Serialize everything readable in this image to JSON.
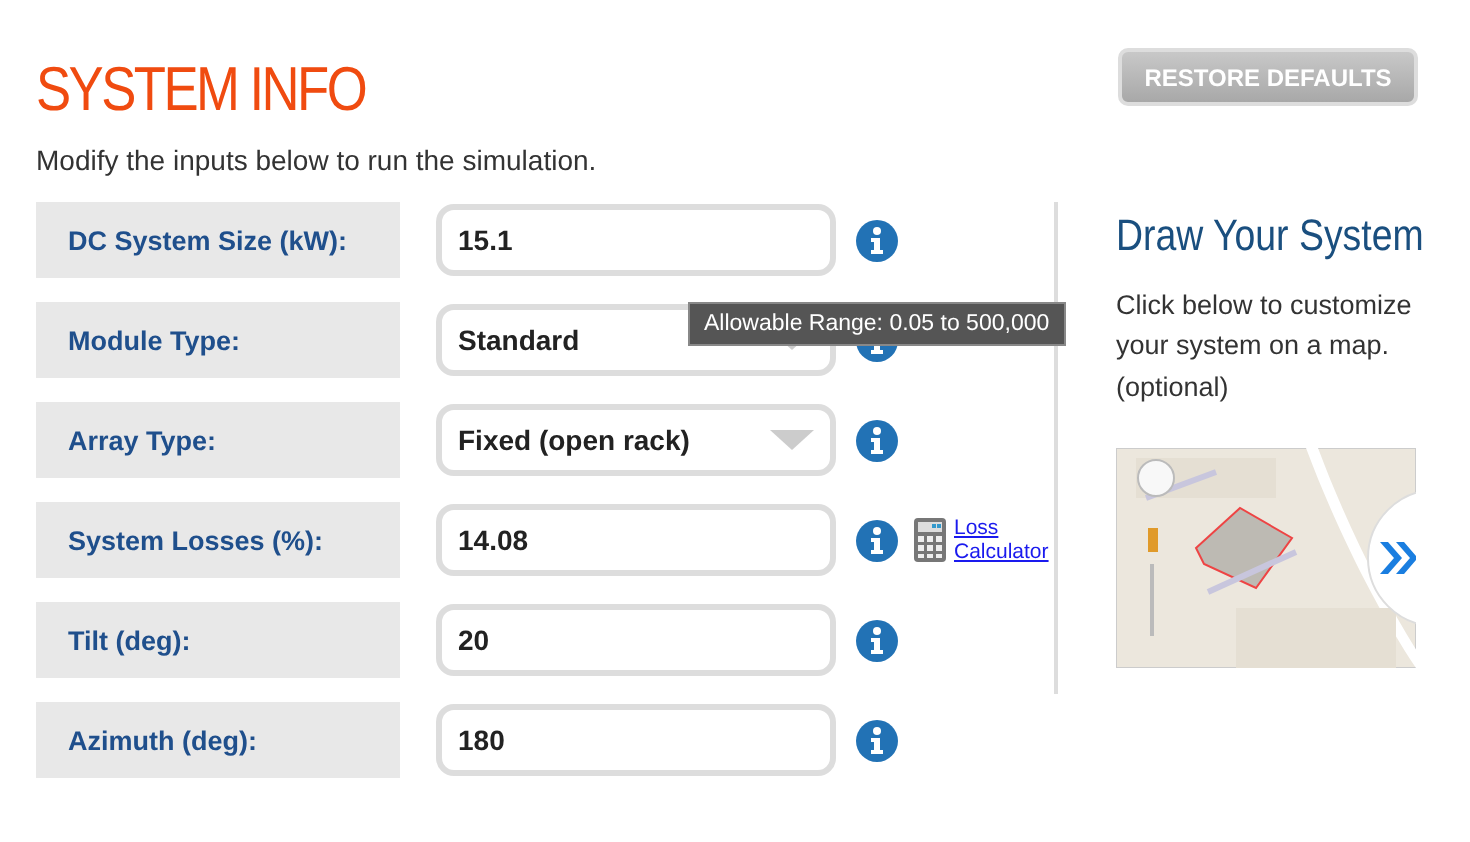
{
  "title": "SYSTEM INFO",
  "restore_button": "RESTORE DEFAULTS",
  "intro": "Modify the inputs below to run the simulation.",
  "fields": [
    {
      "label": "DC System Size (kW):",
      "kind": "input",
      "value": "15.1"
    },
    {
      "label": "Module Type:",
      "kind": "select",
      "value": "Standard"
    },
    {
      "label": "Array Type:",
      "kind": "select",
      "value": "Fixed (open rack)"
    },
    {
      "label": "System Losses (%):",
      "kind": "input",
      "value": "14.08",
      "link": "Loss Calculator"
    },
    {
      "label": "Tilt (deg):",
      "kind": "input",
      "value": "20"
    },
    {
      "label": "Azimuth (deg):",
      "kind": "input",
      "value": "180"
    }
  ],
  "tooltip": {
    "text": "Allowable Range: 0.05 to 500,000"
  },
  "draw_panel": {
    "title": "Draw Your System",
    "text": "Click below to customize your system on a map. (optional)"
  }
}
